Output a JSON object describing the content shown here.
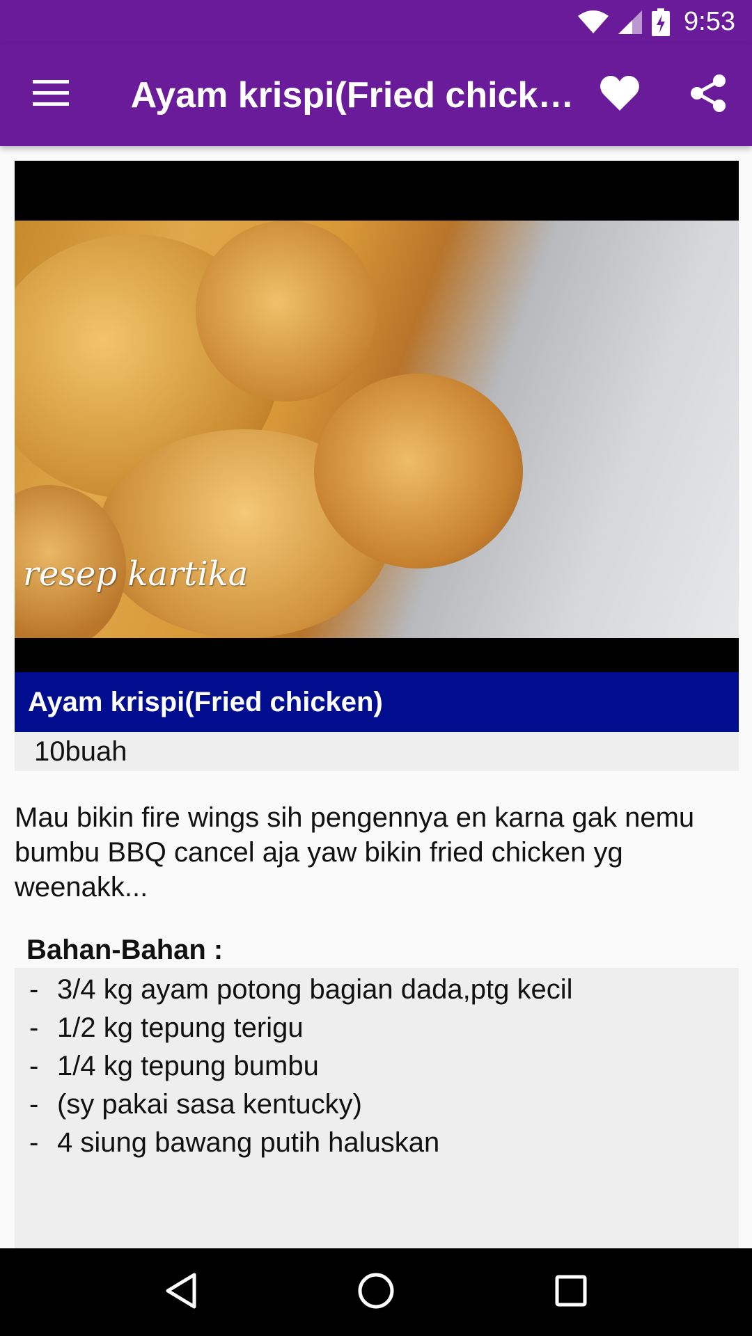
{
  "status_bar": {
    "time": "9:53"
  },
  "app_bar": {
    "title": "Ayam krispi(Fried chick…",
    "icons": [
      "menu-icon",
      "heart-icon",
      "share-icon"
    ]
  },
  "recipe": {
    "photo_watermark": "resep kartika",
    "title": "Ayam krispi(Fried chicken)",
    "portion": "10buah",
    "description": "Mau bikin fire wings sih pengennya en karna gak nemu bumbu BBQ cancel aja yaw bikin fried chicken yg weenakk...",
    "ingredients_title": "Bahan-Bahan :",
    "ingredients": [
      "3/4 kg ayam potong bagian dada,ptg kecil",
      "1/2 kg tepung terigu",
      "1/4 kg tepung bumbu",
      "(sy pakai sasa kentucky)",
      "4 siung bawang putih haluskan"
    ],
    "bullet": "-"
  },
  "nav_bar": {
    "icons": [
      "back-icon",
      "home-icon",
      "recents-icon"
    ]
  },
  "colors": {
    "primary": "#6a1b9a",
    "title_band": "#000d8f",
    "row_background": "#eeeeee"
  }
}
